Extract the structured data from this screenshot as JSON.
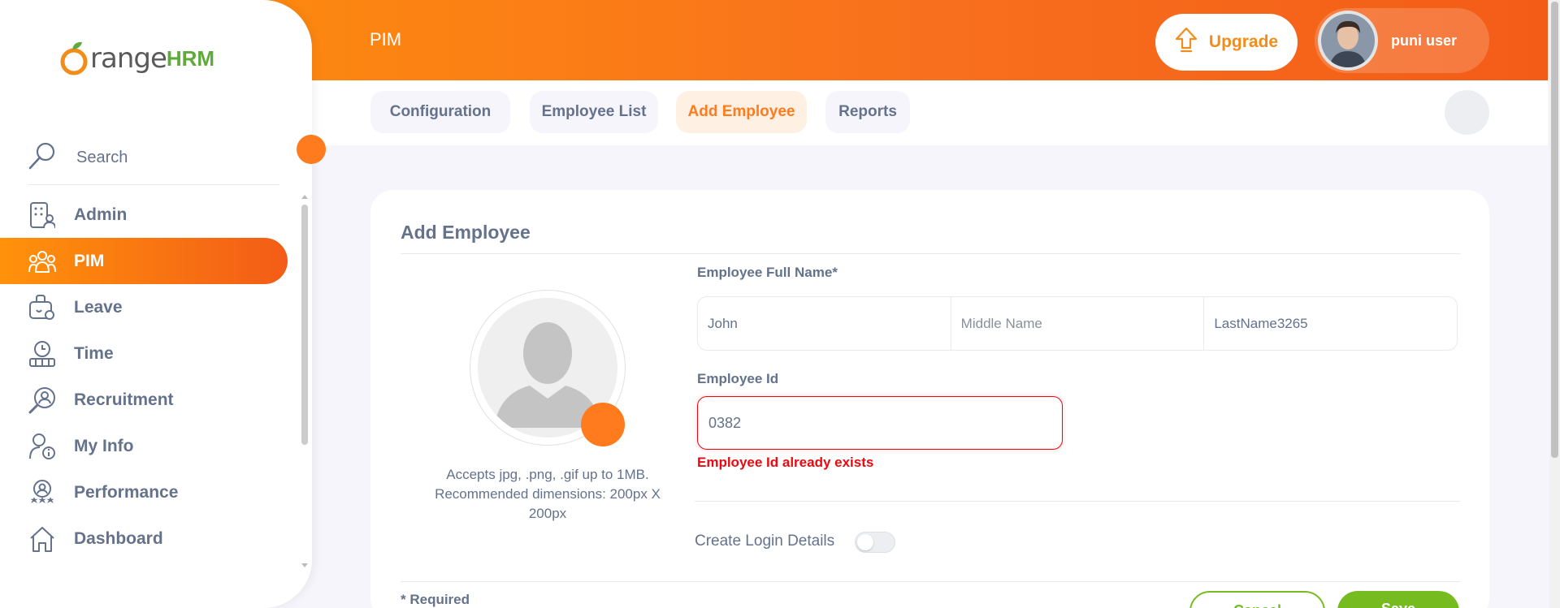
{
  "header": {
    "title": "PIM",
    "upgrade_label": "Upgrade",
    "user_name": "puni user",
    "user_chevron": "",
    "accent_color": "#ff7b1d"
  },
  "topnav": {
    "items": [
      {
        "label": "Configuration ",
        "active": false
      },
      {
        "label": "Employee List",
        "active": false
      },
      {
        "label": "Add Employee",
        "active": true
      },
      {
        "label": "Reports",
        "active": false
      }
    ],
    "help_icon": ""
  },
  "sidebar": {
    "logo_text": "range",
    "logo_hrm": "HRM",
    "search_label": "Search",
    "collapse_icon": "",
    "items": [
      {
        "label": "Admin",
        "icon": "admin-icon",
        "active": false
      },
      {
        "label": "PIM",
        "icon": "pim-icon",
        "active": true
      },
      {
        "label": "Leave",
        "icon": "leave-icon",
        "active": false
      },
      {
        "label": "Time",
        "icon": "time-icon",
        "active": false
      },
      {
        "label": "Recruitment",
        "icon": "recruitment-icon",
        "active": false
      },
      {
        "label": "My Info",
        "icon": "my-info-icon",
        "active": false
      },
      {
        "label": "Performance",
        "icon": "performance-icon",
        "active": false
      },
      {
        "label": "Dashboard",
        "icon": "dashboard-icon",
        "active": false
      }
    ]
  },
  "form": {
    "title": "Add Employee",
    "photo_hint": "Accepts jpg, .png, .gif up to 1MB. Recommended dimensions: 200px X 200px",
    "photo_button_icon": "",
    "full_name_label": "Employee Full Name*",
    "first_name_value": "John",
    "middle_name_placeholder": "Middle Name",
    "last_name_value": "LastName3265",
    "employee_id_label": "Employee Id",
    "employee_id_value": "0382",
    "employee_id_error": "Employee Id already exists",
    "create_login_label": "Create Login Details",
    "create_login_enabled": false,
    "required_note": "* Required",
    "cancel_label": "Cancel",
    "save_label": "Save"
  }
}
